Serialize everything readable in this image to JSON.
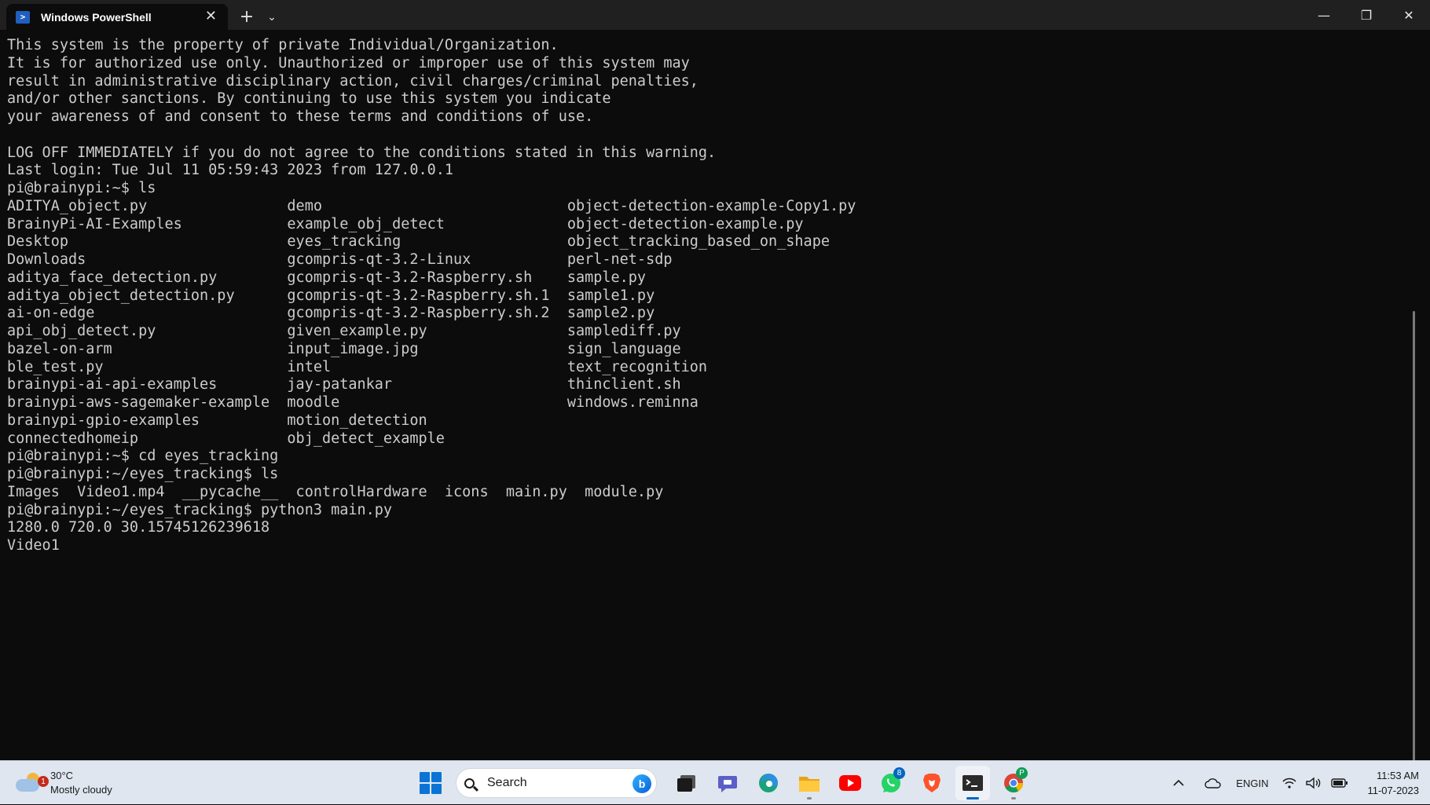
{
  "window": {
    "tab_title": "Windows PowerShell",
    "tab_icon": "powershell-icon",
    "close_tab_glyph": "✕",
    "new_tab_glyph": "+",
    "dropdown_glyph": "⌄",
    "minimize_glyph": "—",
    "maximize_glyph": "❐",
    "close_glyph": "✕"
  },
  "terminal": {
    "lines": [
      "This system is the property of private Individual/Organization.",
      "It is for authorized use only. Unauthorized or improper use of this system may",
      "result in administrative disciplinary action, civil charges/criminal penalties,",
      "and/or other sanctions. By continuing to use this system you indicate",
      "your awareness of and consent to these terms and conditions of use.",
      "",
      "LOG OFF IMMEDIATELY if you do not agree to the conditions stated in this warning.",
      "Last login: Tue Jul 11 05:59:43 2023 from 127.0.0.1",
      "pi@brainypi:~$ ls",
      "ADITYA_object.py                demo                            object-detection-example-Copy1.py",
      "BrainyPi-AI-Examples            example_obj_detect              object-detection-example.py",
      "Desktop                         eyes_tracking                   object_tracking_based_on_shape",
      "Downloads                       gcompris-qt-3.2-Linux           perl-net-sdp",
      "aditya_face_detection.py        gcompris-qt-3.2-Raspberry.sh    sample.py",
      "aditya_object_detection.py      gcompris-qt-3.2-Raspberry.sh.1  sample1.py",
      "ai-on-edge                      gcompris-qt-3.2-Raspberry.sh.2  sample2.py",
      "api_obj_detect.py               given_example.py                samplediff.py",
      "bazel-on-arm                    input_image.jpg                 sign_language",
      "ble_test.py                     intel                           text_recognition",
      "brainypi-ai-api-examples        jay-patankar                    thinclient.sh",
      "brainypi-aws-sagemaker-example  moodle                          windows.reminna",
      "brainypi-gpio-examples          motion_detection",
      "connectedhomeip                 obj_detect_example",
      "pi@brainypi:~$ cd eyes_tracking",
      "pi@brainypi:~/eyes_tracking$ ls",
      "Images  Video1.mp4  __pycache__  controlHardware  icons  main.py  module.py",
      "pi@brainypi:~/eyes_tracking$ python3 main.py",
      "1280.0 720.0 30.15745126239618",
      "Video1"
    ]
  },
  "taskbar": {
    "weather": {
      "temperature": "30°C",
      "condition": "Mostly cloudy",
      "badge": "1"
    },
    "search_label": "Search",
    "bing_glyph": "b",
    "whatsapp_badge": "8",
    "chrome_profile_letter": "P",
    "tray": {
      "chevron_glyph": "^",
      "lang_top": "ENG",
      "lang_bottom": "IN",
      "time": "11:53 AM",
      "date": "11-07-2023"
    }
  }
}
